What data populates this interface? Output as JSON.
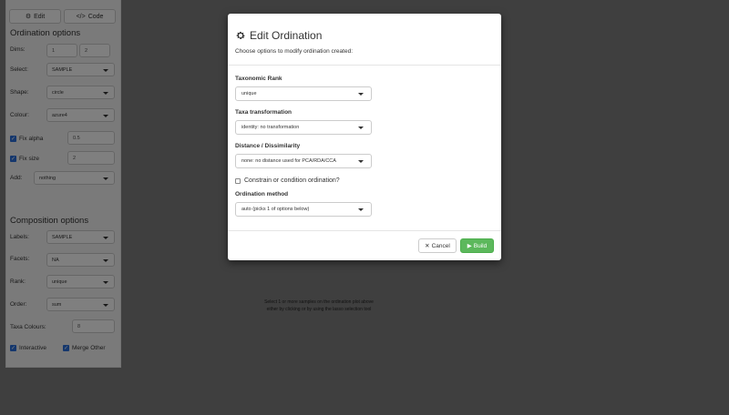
{
  "sidebar": {
    "edit_label": "Edit",
    "code_label": "Code",
    "ordination_title": "Ordination options",
    "dims_label": "Dims:",
    "dims_1": "1",
    "dims_2": "2",
    "select_label": "Select:",
    "select_value": "SAMPLE",
    "shape_label": "Shape:",
    "shape_value": "circle",
    "colour_label": "Colour:",
    "colour_value": "azure4",
    "fix_alpha_label": "Fix alpha",
    "fix_alpha_value": "0.5",
    "fix_size_label": "Fix size",
    "fix_size_value": "2",
    "add_label": "Add:",
    "add_value": "nothing",
    "composition_title": "Composition options",
    "labels_label": "Labels:",
    "labels_value": "SAMPLE",
    "facets_label": "Facets:",
    "facets_value": "NA",
    "rank_label": "Rank:",
    "rank_value": "unique",
    "order_label": "Order:",
    "order_value": "sum",
    "taxa_colours_label": "Taxa Colours:",
    "taxa_colours_value": "8",
    "interactive_label": "Interactive",
    "merge_other_label": "Merge Other"
  },
  "caption": {
    "line1": "Select 1 or more samples on the ordination plot above",
    "line2": "either by clicking or by using the lasso selection tool"
  },
  "modal": {
    "title": "Edit Ordination",
    "subtitle": "Choose options to modify ordination created:",
    "taxonomic_rank_label": "Taxonomic Rank",
    "taxonomic_rank_value": "unique",
    "taxa_transformation_label": "Taxa transformation",
    "taxa_transformation_value": "identity: no transformation",
    "distance_label": "Distance / Dissimilarity",
    "distance_value": "none: no distance used for PCA/RDA/CCA",
    "constrain_label": "Constrain or condition ordination?",
    "method_label": "Ordination method",
    "method_value": "auto (picks 1 of options below)",
    "cancel_label": "Cancel",
    "build_label": "Build"
  },
  "icons": {
    "gear": "gear-icon",
    "code": "code-icon",
    "close": "close-icon",
    "play": "play-icon"
  },
  "colors": {
    "build_button": "#5cb85c",
    "checkbox_checked": "#2a6fdb"
  }
}
